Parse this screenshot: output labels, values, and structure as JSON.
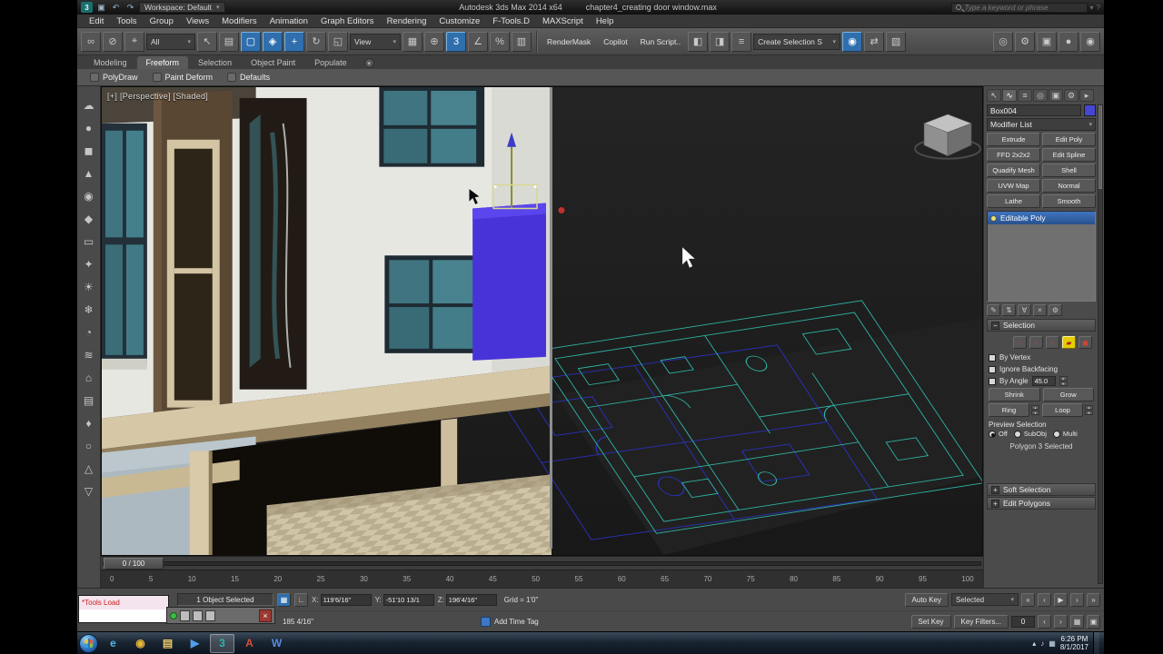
{
  "accent": {
    "selection_fill": "#4833d8",
    "wire_teal": "#2fb3a3",
    "wire_blue": "#2a33cc",
    "highlight_blue": "#2f6fae"
  },
  "titlebar": {
    "workspace": "Workspace: Default",
    "title_product": "Autodesk 3ds Max 2014 x64",
    "title_file": "chapter4_creating door window.max",
    "search_placeholder": "Type a keyword or phrase"
  },
  "menubar": {
    "items": [
      "Edit",
      "Tools",
      "Group",
      "Views",
      "Modifiers",
      "Animation",
      "Graph Editors",
      "Rendering",
      "Customize",
      "F-Tools.D",
      "MAXScript",
      "Help"
    ]
  },
  "toolbar": {
    "filter_value": "All",
    "view_value": "View",
    "rendermask": "RenderMask",
    "copilot": "Copilot",
    "runscript": "Run Script..",
    "selection_set": "Create Selection S",
    "g1": [
      {
        "g": "∞"
      },
      {
        "g": "⊘"
      },
      {
        "g": "⌖"
      }
    ],
    "g2": [
      {
        "g": "↖"
      },
      {
        "g": "▤"
      },
      {
        "g": "▢",
        "active": true
      },
      {
        "g": "◈",
        "active": true
      }
    ],
    "g3": [
      {
        "g": "+",
        "active": true
      },
      {
        "g": "↻"
      },
      {
        "g": "◱"
      }
    ],
    "g4": [
      {
        "g": "▦"
      },
      {
        "g": "⊕"
      }
    ],
    "g5": [
      {
        "g": "3",
        "active": true
      },
      {
        "g": "∠"
      },
      {
        "g": "%"
      },
      {
        "g": "▥"
      }
    ],
    "g6": [
      {
        "g": "◧"
      },
      {
        "g": "◨"
      },
      {
        "g": "≡"
      }
    ],
    "g7": [
      {
        "g": "◉",
        "active": true
      },
      {
        "g": "⇄"
      },
      {
        "g": "▧"
      }
    ],
    "g8": [
      {
        "g": "◎"
      },
      {
        "g": "⚙"
      },
      {
        "g": "▣"
      },
      {
        "g": "●"
      },
      {
        "g": "◉"
      }
    ]
  },
  "ribbon": {
    "tabs": [
      {
        "label": "Modeling"
      },
      {
        "label": "Freeform",
        "active": true
      },
      {
        "label": "Selection"
      },
      {
        "label": "Object Paint"
      },
      {
        "label": "Populate"
      }
    ],
    "sub": [
      "PolyDraw",
      "Paint Deform",
      "Defaults"
    ]
  },
  "left_toolbar": {
    "icons": [
      "☁",
      "●",
      "◼",
      "▲",
      "◉",
      "◆",
      "▭",
      "✦",
      "☀",
      "❄",
      "◔",
      "≋",
      "⌂",
      "▤",
      "♦",
      "○",
      "△",
      "▽"
    ]
  },
  "viewport": {
    "label": "[+] [Perspective] [Shaded]"
  },
  "command_panel": {
    "tabs": [
      {
        "g": "↖"
      },
      {
        "g": "∿",
        "active": true
      },
      {
        "g": "≡"
      },
      {
        "g": "◎"
      },
      {
        "g": "▣"
      },
      {
        "g": "⚙"
      },
      {
        "g": "▸"
      }
    ],
    "object_name": "Box004",
    "modifier_list": "Modifier List",
    "modifier_buttons": [
      "Extrude",
      "Edit Poly",
      "FFD 2x2x2",
      "Edit Spline",
      "Quadify Mesh",
      "Shell",
      "UVW Map",
      "Normal",
      "Lathe",
      "Smooth"
    ],
    "stack_item": "Editable Poly",
    "stack_tools": [
      "✎",
      "⇅",
      "∀",
      "×",
      "⚙"
    ],
    "expand_glyph": "+",
    "collapse_glyph": "−",
    "selection": {
      "title": "Selection",
      "subobject_icons": [
        {
          "g": "∴"
        },
        {
          "g": "∕"
        },
        {
          "g": "○"
        },
        {
          "g": "▰",
          "active": true
        },
        {
          "g": "◼"
        }
      ],
      "by_vertex": "By Vertex",
      "ignore_backfacing": "Ignore Backfacing",
      "by_angle": "By Angle",
      "by_angle_value": "45.0",
      "shrink": "Shrink",
      "grow": "Grow",
      "ring": "Ring",
      "loop": "Loop",
      "preview": "Preview Selection",
      "preview_options": [
        {
          "label": "Off",
          "active": true
        },
        {
          "label": "SubObj"
        },
        {
          "label": "Multi"
        }
      ],
      "status": "Polygon 3 Selected"
    },
    "rollouts": [
      "Soft Selection",
      "Edit Polygons"
    ]
  },
  "timeline": {
    "slider_label": "0 / 100",
    "ticks": [
      "0",
      "5",
      "10",
      "15",
      "20",
      "25",
      "30",
      "35",
      "40",
      "45",
      "50",
      "55",
      "60",
      "65",
      "70",
      "75",
      "80",
      "85",
      "90",
      "95",
      "100"
    ]
  },
  "statusbar": {
    "selection_status": "1 Object Selected",
    "listener_line": "*Tools Load",
    "prompt": "185 4/16\"",
    "x_label": "X:",
    "x_value": "119'6/16\"",
    "y_label": "Y:",
    "y_value": "-51'10 13/1",
    "z_label": "Z:",
    "z_value": "196'4/16\"",
    "grid": "Grid = 1'0\"",
    "autokey": "Auto Key",
    "selected_dropdown": "Selected",
    "setkey": "Set Key",
    "keyfilters": "Key Filters...",
    "addtimetag": "Add Time Tag",
    "frame_field": "0",
    "playback1": [
      "«",
      "‹",
      "▶",
      "›",
      "»"
    ],
    "playback2": [
      "‹",
      "›"
    ],
    "right_icons": [
      "▦",
      "▣"
    ]
  },
  "floating_bar": {
    "close": "×"
  },
  "taskbar": {
    "items": [
      {
        "name": "internet-explorer",
        "g": "e",
        "color": "#53b7e8"
      },
      {
        "name": "chrome",
        "g": "◉",
        "color": "#e8b73a"
      },
      {
        "name": "folder",
        "g": "▤",
        "color": "#e8c968"
      },
      {
        "name": "media-player",
        "g": "▶",
        "color": "#4f9fe8"
      },
      {
        "name": "3ds-max",
        "g": "3",
        "color": "#2ab4ac",
        "active": true
      },
      {
        "name": "adobe",
        "g": "A",
        "color": "#d84c3a"
      },
      {
        "name": "word",
        "g": "W",
        "color": "#5a8ade"
      }
    ],
    "tray_icons": [
      "▴",
      "♪",
      "▦"
    ],
    "tray": {
      "time": "6:26 PM",
      "date": "8/1/2017"
    }
  }
}
